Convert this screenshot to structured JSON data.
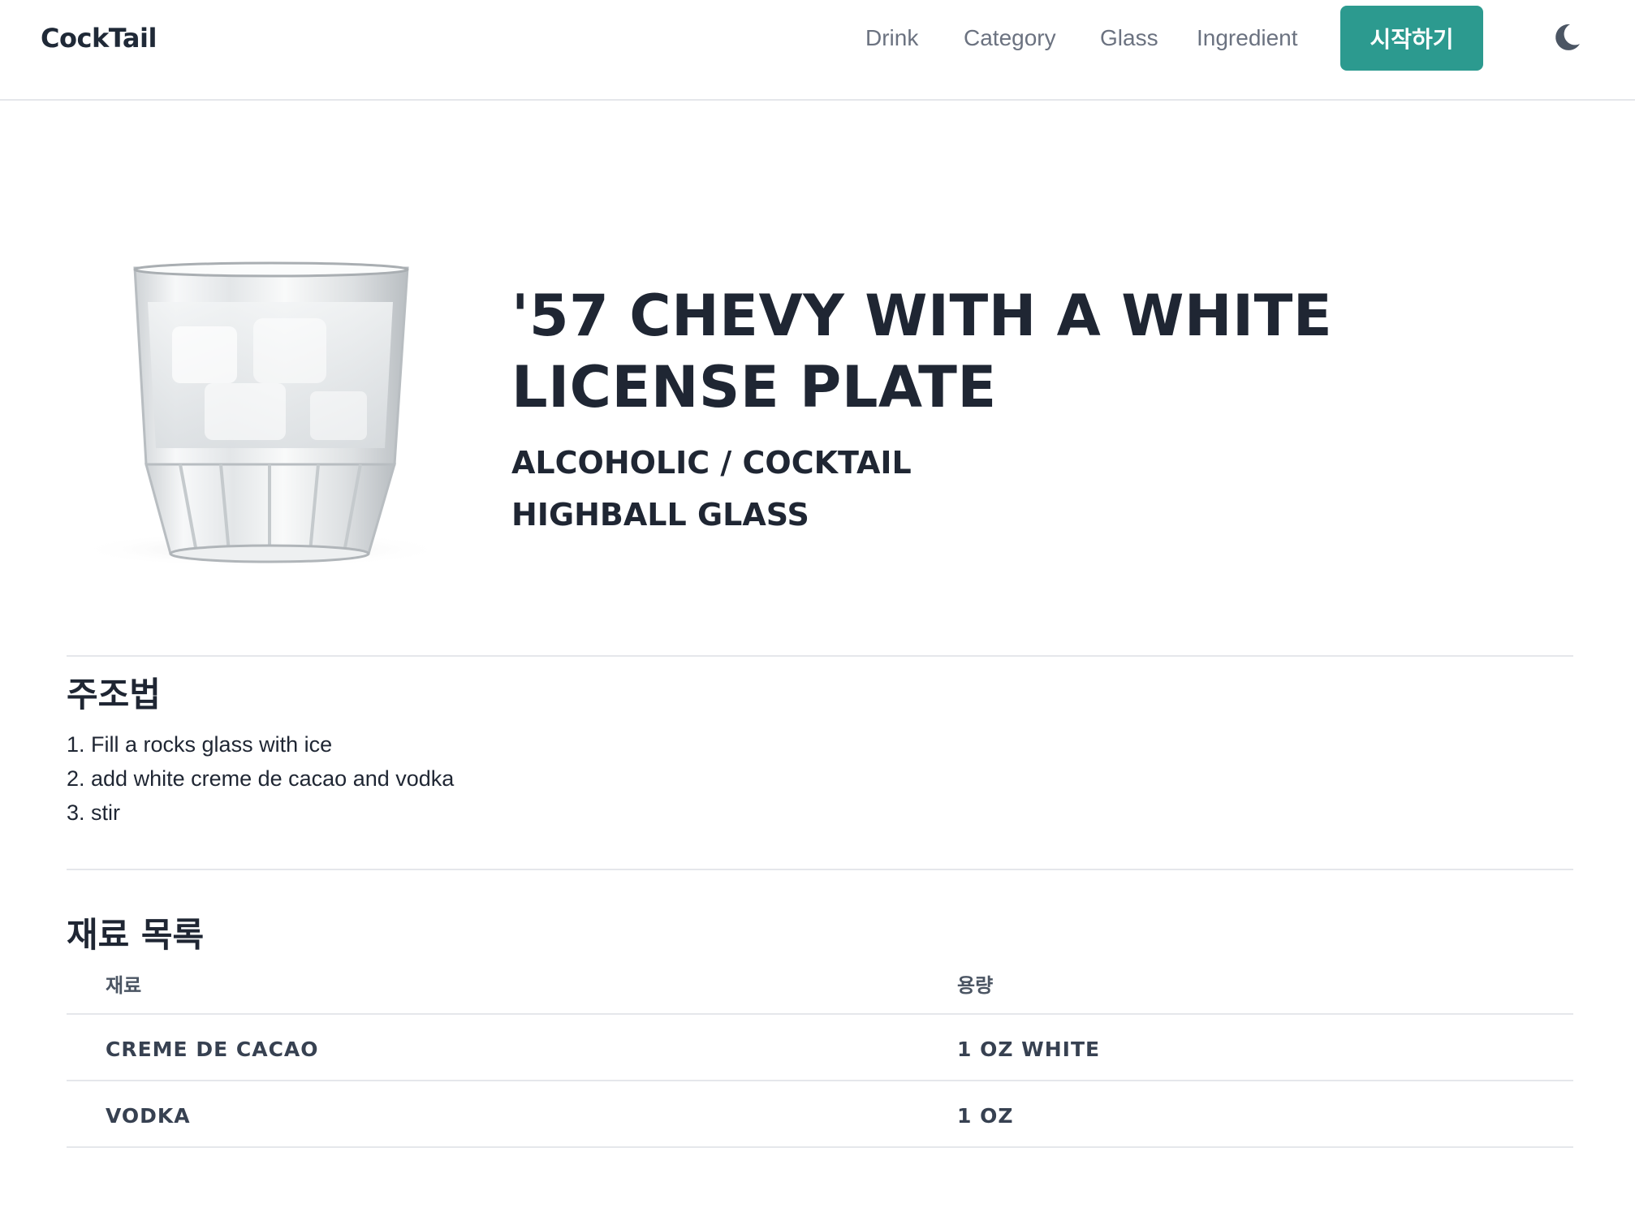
{
  "header": {
    "brand": "CockTail",
    "nav": [
      "Drink",
      "Category",
      "Glass",
      "Ingredient"
    ],
    "start_label": "시작하기",
    "theme_icon": "moon-icon",
    "accent_color": "#2c9a8f"
  },
  "drink": {
    "title": "'57 CHEVY WITH A WHITE LICENSE PLATE",
    "category": "ALCOHOLIC / COCKTAIL",
    "glass": "HIGHBALL GLASS",
    "image_icon": "glass-image"
  },
  "recipe": {
    "title": "주조법",
    "steps": [
      "1. Fill a rocks glass with ice",
      "2. add white creme de cacao and vodka",
      "3. stir"
    ]
  },
  "ingredients": {
    "title": "재료 목록",
    "headers": [
      "재료",
      "용량"
    ],
    "rows": [
      [
        "CREME DE CACAO",
        "1 OZ WHITE"
      ],
      [
        "VODKA",
        "1 OZ"
      ]
    ]
  }
}
